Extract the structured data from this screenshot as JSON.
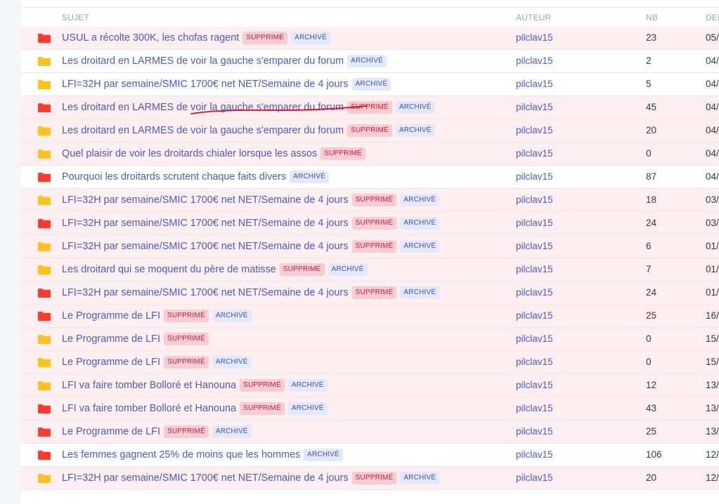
{
  "header": {
    "sujet": "SUJET",
    "auteur": "AUTEUR",
    "nb": "NB",
    "der": "DER"
  },
  "badges": {
    "supprime": "SUPPRIMÉ",
    "archive": "ARCHIVÉ"
  },
  "colors": {
    "folder_red": "#ff3b30",
    "folder_yellow": "#ffc21a",
    "annotation": "#e0101a"
  },
  "topics": [
    {
      "title": "USUL a récolte 300K, les chofas ragent",
      "folder": "red",
      "supprime": true,
      "archive": true,
      "author": "pilclav15",
      "nb": "23",
      "date": "05/"
    },
    {
      "title": "Les droitard en LARMES de voir la gauche s'emparer du forum",
      "folder": "yellow",
      "supprime": false,
      "archive": true,
      "author": "pilclav15",
      "nb": "2",
      "date": "04/"
    },
    {
      "title": "LFI=32H par semaine/SMIC 1700€ net NET/Semaine de 4 jours",
      "folder": "yellow",
      "supprime": false,
      "archive": true,
      "author": "pilclav15",
      "nb": "5",
      "date": "04/"
    },
    {
      "title": "Les droitard en LARMES de voir la gauche s'emparer du forum",
      "folder": "red",
      "supprime": true,
      "archive": true,
      "author": "pilclav15",
      "nb": "45",
      "date": "04/"
    },
    {
      "title": "Les droitard en LARMES de voir la gauche s'emparer du forum",
      "folder": "yellow",
      "supprime": true,
      "archive": true,
      "author": "pilclav15",
      "nb": "20",
      "date": "04/"
    },
    {
      "title": "Quel plaisir de voir les droitards chialer lorsque les assos",
      "folder": "yellow",
      "supprime": true,
      "archive": false,
      "author": "pilclav15",
      "nb": "0",
      "date": "04/"
    },
    {
      "title": "Pourquoi les droitards scrutent chaque faits divers",
      "folder": "red",
      "supprime": false,
      "archive": true,
      "author": "pilclav15",
      "nb": "87",
      "date": "04/"
    },
    {
      "title": "LFI=32H par semaine/SMIC 1700€ net NET/Semaine de 4 jours",
      "folder": "yellow",
      "supprime": true,
      "archive": true,
      "author": "pilclav15",
      "nb": "18",
      "date": "03/"
    },
    {
      "title": "LFI=32H par semaine/SMIC 1700€ net NET/Semaine de 4 jours",
      "folder": "red",
      "supprime": true,
      "archive": true,
      "author": "pilclav15",
      "nb": "24",
      "date": "03/"
    },
    {
      "title": "LFI=32H par semaine/SMIC 1700€ net NET/Semaine de 4 jours",
      "folder": "yellow",
      "supprime": true,
      "archive": true,
      "author": "pilclav15",
      "nb": "6",
      "date": "01/"
    },
    {
      "title": "Les droitard qui se moquent du père de matisse",
      "folder": "yellow",
      "supprime": true,
      "archive": true,
      "author": "pilclav15",
      "nb": "7",
      "date": "01/"
    },
    {
      "title": "LFI=32H par semaine/SMIC 1700€ net NET/Semaine de 4 jours",
      "folder": "red",
      "supprime": true,
      "archive": true,
      "author": "pilclav15",
      "nb": "24",
      "date": "01/"
    },
    {
      "title": "Le Programme de LFI",
      "folder": "red",
      "supprime": true,
      "archive": true,
      "author": "pilclav15",
      "nb": "25",
      "date": "16/"
    },
    {
      "title": "Le Programme de LFI",
      "folder": "yellow",
      "supprime": true,
      "archive": false,
      "author": "pilclav15",
      "nb": "0",
      "date": "15/"
    },
    {
      "title": "Le Programme de LFI",
      "folder": "yellow",
      "supprime": true,
      "archive": true,
      "author": "pilclav15",
      "nb": "0",
      "date": "15/"
    },
    {
      "title": "LFI va faire tomber Bolloré et Hanouna",
      "folder": "yellow",
      "supprime": true,
      "archive": true,
      "author": "pilclav15",
      "nb": "12",
      "date": "13/"
    },
    {
      "title": "LFI va faire tomber Bolloré et Hanouna",
      "folder": "red",
      "supprime": true,
      "archive": true,
      "author": "pilclav15",
      "nb": "43",
      "date": "13/"
    },
    {
      "title": "Le Programme de LFI",
      "folder": "red",
      "supprime": true,
      "archive": true,
      "author": "pilclav15",
      "nb": "25",
      "date": "13/"
    },
    {
      "title": "Les femmes gagnent 25% de moins que les hommes",
      "folder": "red",
      "supprime": false,
      "archive": true,
      "author": "pilclav15",
      "nb": "106",
      "date": "12/"
    },
    {
      "title": "LFI=32H par semaine/SMIC 1700€ net NET/Semaine de 4 jours",
      "folder": "yellow",
      "supprime": true,
      "archive": true,
      "author": "pilclav15",
      "nb": "20",
      "date": "12/"
    }
  ]
}
